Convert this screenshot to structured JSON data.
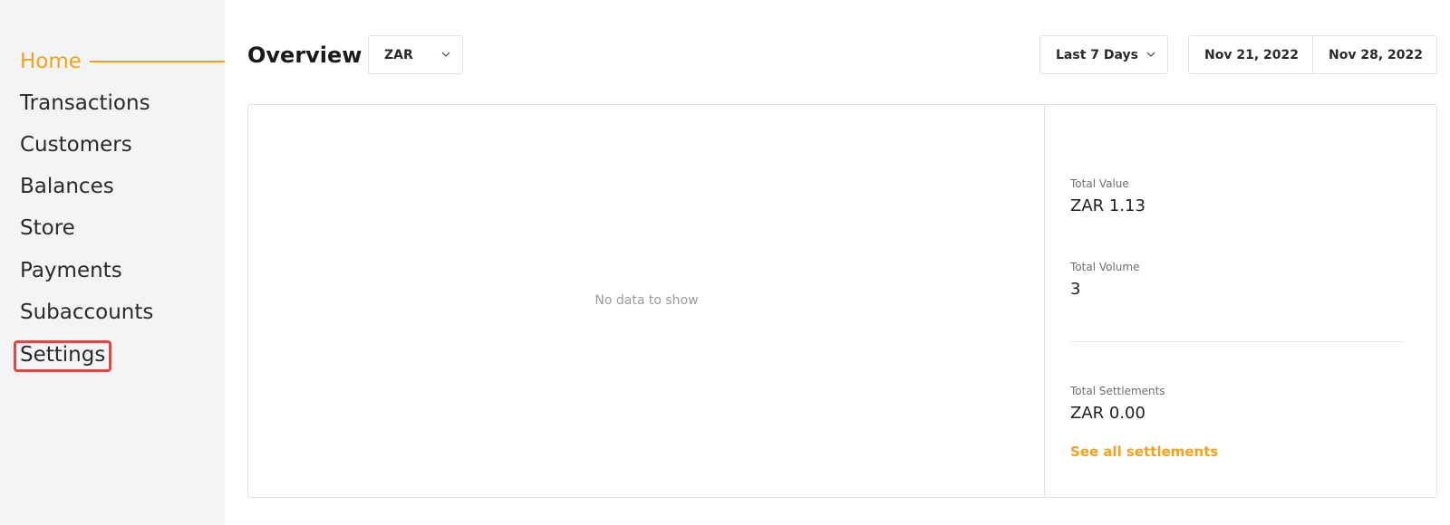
{
  "sidebar": {
    "items": [
      {
        "label": "Home"
      },
      {
        "label": "Transactions"
      },
      {
        "label": "Customers"
      },
      {
        "label": "Balances"
      },
      {
        "label": "Store"
      },
      {
        "label": "Payments"
      },
      {
        "label": "Subaccounts"
      },
      {
        "label": "Settings"
      }
    ],
    "active": "Home"
  },
  "header": {
    "title": "Overview",
    "currency": "ZAR",
    "range": "Last 7 Days",
    "start_date": "Nov 21, 2022",
    "end_date": "Nov 28, 2022"
  },
  "chart": {
    "empty_message": "No data to show"
  },
  "stats": {
    "total_value_label": "Total Value",
    "total_value": "ZAR 1.13",
    "total_volume_label": "Total Volume",
    "total_volume": "3",
    "total_settlements_label": "Total Settlements",
    "total_settlements": "ZAR 0.00",
    "settlements_link": "See all settlements"
  },
  "colors": {
    "accent": "#f2a21b",
    "highlight": "#e04848",
    "sidebar_bg": "#f3f4f6"
  },
  "icons": {
    "dropdown": "chevron-down-icon"
  }
}
